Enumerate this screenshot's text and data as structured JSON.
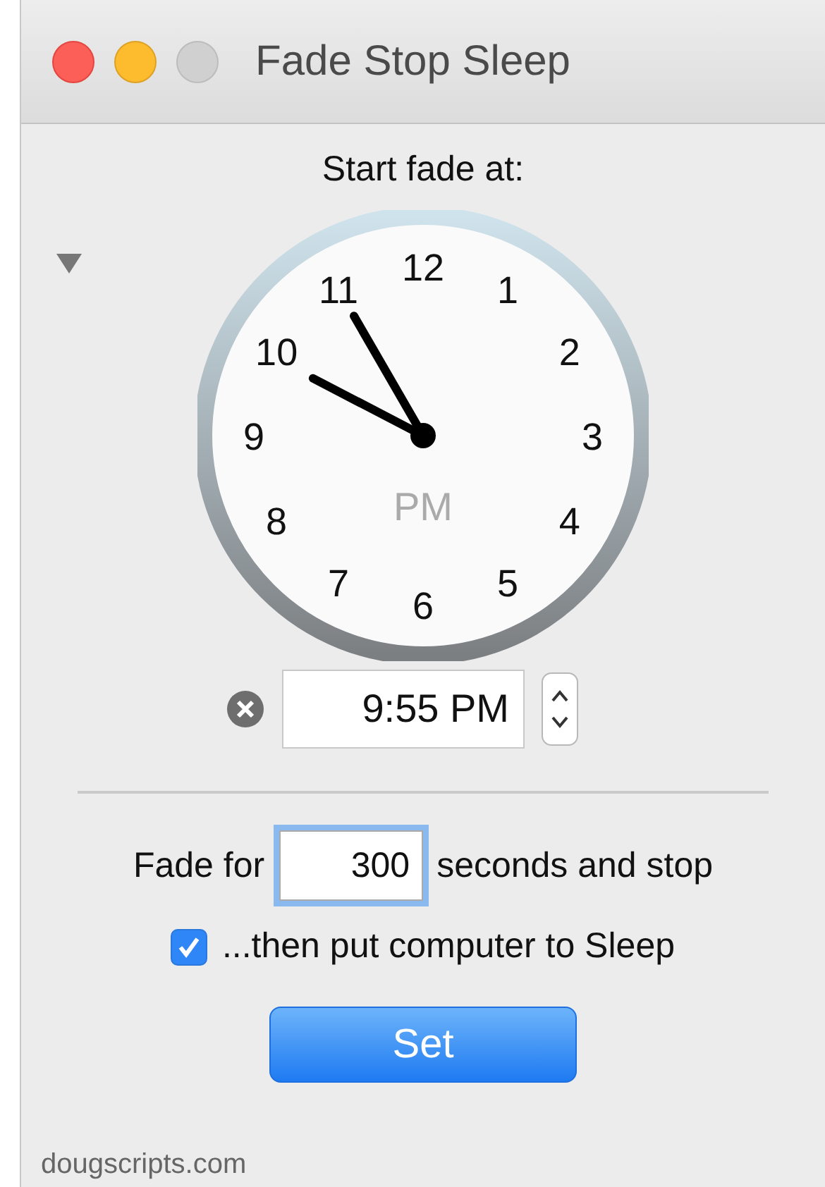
{
  "window": {
    "title": "Fade Stop Sleep"
  },
  "heading": "Start fade at:",
  "disclosure": {
    "expanded": true
  },
  "clock": {
    "numerals": [
      "12",
      "1",
      "2",
      "3",
      "4",
      "5",
      "6",
      "7",
      "8",
      "9",
      "10",
      "11"
    ],
    "meridiem": "PM"
  },
  "time_field": {
    "value": "9:55 PM"
  },
  "fade_row": {
    "label": "Fade for",
    "value": "300",
    "suffix": "seconds and stop"
  },
  "sleep_checkbox": {
    "label": "...then put computer to Sleep",
    "checked": true
  },
  "buttons": [
    "Set"
  ],
  "footer": "dougscripts.com"
}
